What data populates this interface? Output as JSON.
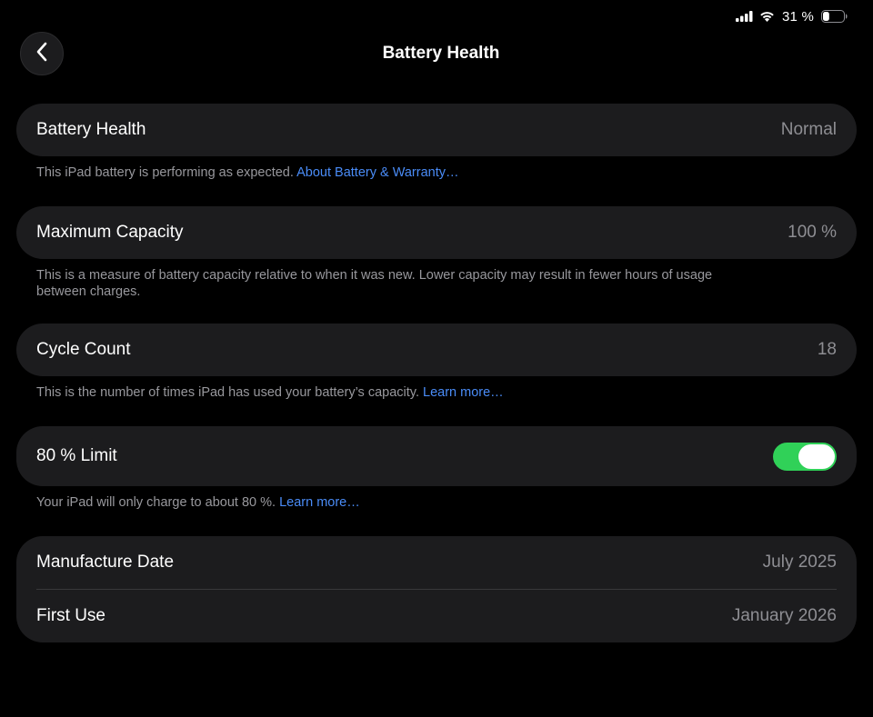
{
  "status_bar": {
    "battery_percent": "31 %",
    "icons": [
      "cellular-signal-icon",
      "wifi-icon",
      "battery-icon"
    ],
    "battery_level": 0.31
  },
  "header": {
    "title": "Battery Health",
    "back_icon": "chevron-left-icon"
  },
  "battery_health": {
    "label": "Battery Health",
    "value": "Normal",
    "footnote": "This iPad battery is performing as expected.",
    "link": "About Battery & Warranty…"
  },
  "max_capacity": {
    "label": "Maximum Capacity",
    "value": "100 %",
    "footnote": "This is a measure of battery capacity relative to when it was new. Lower capacity may result in fewer hours of usage between charges."
  },
  "cycle_count": {
    "label": "Cycle Count",
    "value": "18",
    "footnote": "This is the number of times iPad has used your battery’s capacity.",
    "link": "Learn more…"
  },
  "limit": {
    "label": "80 % Limit",
    "toggle_on": true,
    "footnote": "Your iPad will only charge to about 80 %.",
    "link": "Learn more…"
  },
  "dates": {
    "manufacture_label": "Manufacture Date",
    "manufacture_value": "July 2025",
    "first_use_label": "First Use",
    "first_use_value": "January 2026"
  },
  "colors": {
    "background": "#000000",
    "card": "#1c1c1e",
    "link": "#4a8cf7",
    "toggle_on": "#30d158",
    "secondary_text": "#8e8e93"
  }
}
